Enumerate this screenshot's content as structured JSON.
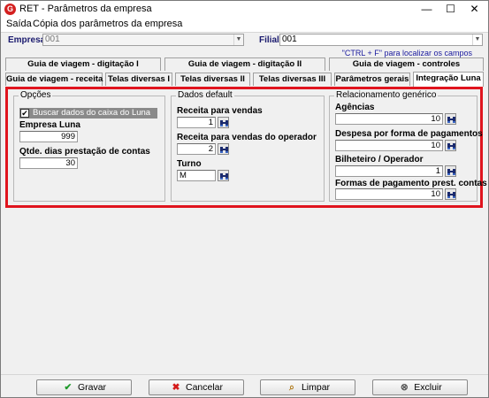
{
  "window": {
    "title": "RET - Parâmetros da empresa",
    "logo_letter": "G",
    "controls": {
      "minimize": "—",
      "maximize": "☐",
      "close": "✕"
    }
  },
  "menu": {
    "items": [
      "Saída",
      "Cópia dos parâmetros da empresa"
    ]
  },
  "filters": {
    "empresa_label": "Empresa",
    "empresa_value": "001",
    "filial_label": "Filial",
    "filial_value": "001"
  },
  "hint": "\"CTRL + F\" para localizar os campos",
  "tabs_row1": [
    "Guia de viagem - digitação I",
    "Guia de viagem - digitação II",
    "Guia de viagem - controles"
  ],
  "tabs_row2": [
    "Guia de viagem - receita",
    "Telas diversas I",
    "Telas diversas II",
    "Telas diversas III",
    "Parâmetros gerais",
    "Integração Luna"
  ],
  "active_tab": "Integração Luna",
  "opcoes": {
    "title": "Opções",
    "checkbox_label": "Buscar dados do caixa do Luna",
    "checkbox_checked": true,
    "empresa_luna_label": "Empresa Luna",
    "empresa_luna_value": "999",
    "qtde_label": "Qtde. dias prestação de contas",
    "qtde_value": "30"
  },
  "dados_default": {
    "title": "Dados default",
    "receita_label": "Receita para vendas",
    "receita_value": "1",
    "receita_op_label": "Receita para vendas do operador",
    "receita_op_value": "2",
    "turno_label": "Turno",
    "turno_value": "M"
  },
  "relacionamento": {
    "title": "Relacionamento genérico",
    "agencias_label": "Agências",
    "agencias_value": "10",
    "despesa_label": "Despesa por forma de pagamentos",
    "despesa_value": "10",
    "bilheteiro_label": "Bilheteiro / Operador",
    "bilheteiro_value": "1",
    "formas_label": "Formas de pagamento prest. contas",
    "formas_value": "10"
  },
  "buttons": {
    "gravar": "Gravar",
    "cancelar": "Cancelar",
    "limpar": "Limpar",
    "excluir": "Excluir"
  },
  "colors": {
    "highlight": "#e0141e",
    "label_blue": "#1a1a6e",
    "hint_blue": "#1a1a9e"
  }
}
